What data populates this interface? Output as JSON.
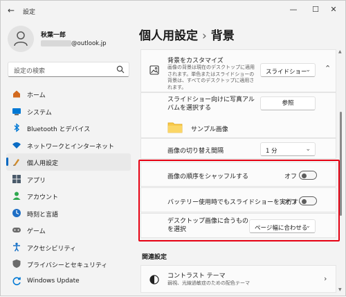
{
  "app": {
    "title": "設定"
  },
  "window_controls": {
    "minimize": "—",
    "maximize": "☐",
    "close": "✕"
  },
  "profile": {
    "name": "秋葉一郎",
    "email_suffix": "@outlook.jp"
  },
  "search": {
    "placeholder": "設定の検索"
  },
  "nav": {
    "items": [
      {
        "label": "ホーム",
        "icon": "home-icon",
        "color": "#d2691e"
      },
      {
        "label": "システム",
        "icon": "system-icon",
        "color": "#0078d4"
      },
      {
        "label": "Bluetooth とデバイス",
        "icon": "bluetooth-icon",
        "color": "#0078d4"
      },
      {
        "label": "ネットワークとインターネット",
        "icon": "network-icon",
        "color": "#0a6cc4"
      },
      {
        "label": "個人用設定",
        "icon": "personalization-icon",
        "color": "#d08a2a",
        "active": true
      },
      {
        "label": "アプリ",
        "icon": "apps-icon",
        "color": "#4a5a6a"
      },
      {
        "label": "アカウント",
        "icon": "accounts-icon",
        "color": "#2fa84f"
      },
      {
        "label": "時刻と言語",
        "icon": "time-language-icon",
        "color": "#1f6fc5"
      },
      {
        "label": "ゲーム",
        "icon": "gaming-icon",
        "color": "#6b6b6b"
      },
      {
        "label": "アクセシビリティ",
        "icon": "accessibility-icon",
        "color": "#1a73c7"
      },
      {
        "label": "プライバシーとセキュリティ",
        "icon": "privacy-icon",
        "color": "#6b6b6b"
      },
      {
        "label": "Windows Update",
        "icon": "windows-update-icon",
        "color": "#0078d4"
      }
    ]
  },
  "page": {
    "breadcrumb_parent": "個人用設定",
    "breadcrumb_sep": "›",
    "title": "背景"
  },
  "background_card": {
    "title": "背景をカスタマイズ",
    "desc": "画像の背景は現在のデスクトップに適用されます。単色またはスライドショーの背景は、すべてのデスクトップに適用されます。",
    "value": "スライドショー",
    "icon": "image-icon"
  },
  "album": {
    "label": "スライドショー向けに写真アルバムを選択する",
    "button": "参照",
    "folder_name": "サンプル画像",
    "folder_icon": "folder-icon"
  },
  "interval": {
    "label": "画像の切り替え間隔",
    "value": "1 分"
  },
  "shuffle": {
    "label": "画像の順序をシャッフルする",
    "state": "オフ"
  },
  "battery": {
    "label": "バッテリー使用時でもスライドショーを実行する",
    "state": "オフ"
  },
  "fit": {
    "label": "デスクトップ画像に合うものを選択",
    "value": "ページ幅に合わせる"
  },
  "related": {
    "section_title": "関連設定",
    "contrast": {
      "title": "コントラスト テーマ",
      "desc": "弱視、光線過敏症のための配色テーマ"
    }
  },
  "colors": {
    "accent": "#0067c0",
    "highlight": "#e60012"
  }
}
